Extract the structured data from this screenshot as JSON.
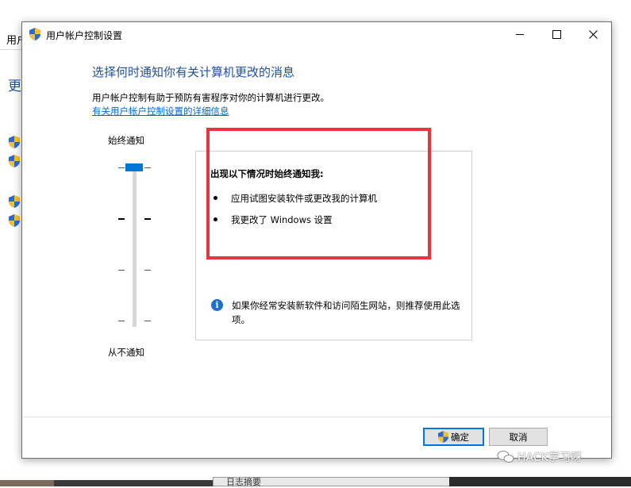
{
  "background": {
    "window_title_fragment": "用户",
    "heading_fragment": "更",
    "taskbar_item_label": "日志摘要"
  },
  "dialog": {
    "title": "用户帐户控制设置",
    "heading": "选择何时通知你有关计算机更改的消息",
    "description": "用户帐户控制有助于预防有害程序对你的计算机进行更改。",
    "details_link": "有关用户帐户控制设置的详细信息",
    "slider": {
      "top_label": "始终通知",
      "bottom_label": "从不通知",
      "level_count": 4,
      "selected_level": 4
    },
    "info": {
      "title": "出现以下情况时始终通知我:",
      "bullets": [
        "应用试图安装软件或更改我的计算机",
        "我更改了 Windows 设置"
      ],
      "note": "如果你经常安装新软件和访问陌生网站，则推荐使用此选项。"
    },
    "buttons": {
      "ok": "确定",
      "cancel": "取消"
    }
  },
  "watermark": "HACK学习呀",
  "colors": {
    "heading": "#1f4f9b",
    "link": "#0066cc",
    "slider_thumb": "#0078d7",
    "highlight_border": "#e8343b",
    "info_icon": "#1e6fc9"
  },
  "icons": {
    "title": "uac-shield-icon",
    "ok": "uac-shield-icon",
    "info": "info-icon",
    "close": "close-icon",
    "minimize": "minimize-icon",
    "maximize": "maximize-icon"
  }
}
